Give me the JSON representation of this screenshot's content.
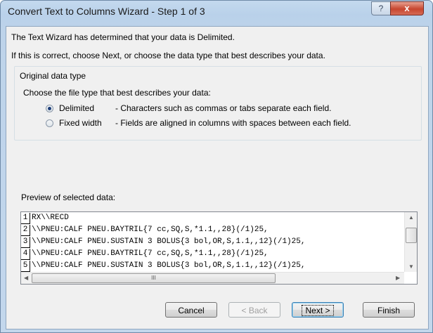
{
  "window": {
    "title": "Convert Text to Columns Wizard - Step 1 of 3",
    "help_label": "?",
    "close_label": "x"
  },
  "intro": {
    "line1": "The Text Wizard has determined that your data is Delimited.",
    "line2": "If this is correct, choose Next, or choose the data type that best describes your data."
  },
  "data_type": {
    "group_label": "Original data type",
    "instruction": "Choose the file type that best describes your data:",
    "options": [
      {
        "label": "Delimited",
        "description": "- Characters such as commas or tabs separate each field.",
        "selected": true
      },
      {
        "label": "Fixed width",
        "description": "- Fields are aligned in columns with spaces between each field.",
        "selected": false
      }
    ]
  },
  "preview": {
    "label": "Preview of selected data:",
    "rows": [
      {
        "num": "1",
        "text": "RX\\\\RECD"
      },
      {
        "num": "2",
        "text": "\\\\PNEU:CALF PNEU.BAYTRIL{7 cc,SQ,S,*1.1,,28}(/1)25,"
      },
      {
        "num": "3",
        "text": "\\\\PNEU:CALF PNEU.SUSTAIN 3 BOLUS{3 bol,OR,S,1.1,,12}(/1)25,"
      },
      {
        "num": "4",
        "text": "\\\\PNEU:CALF PNEU.BAYTRIL{7 cc,SQ,S,*1.1,,28}(/1)25,"
      },
      {
        "num": "5",
        "text": "\\\\PNEU:CALF PNEU.SUSTAIN 3 BOLUS{3 bol,OR,S,1.1,,12}(/1)25,"
      }
    ],
    "hscroll_grip": "III"
  },
  "buttons": {
    "cancel": "Cancel",
    "back": "< Back",
    "next": "Next >",
    "finish": "Finish"
  }
}
